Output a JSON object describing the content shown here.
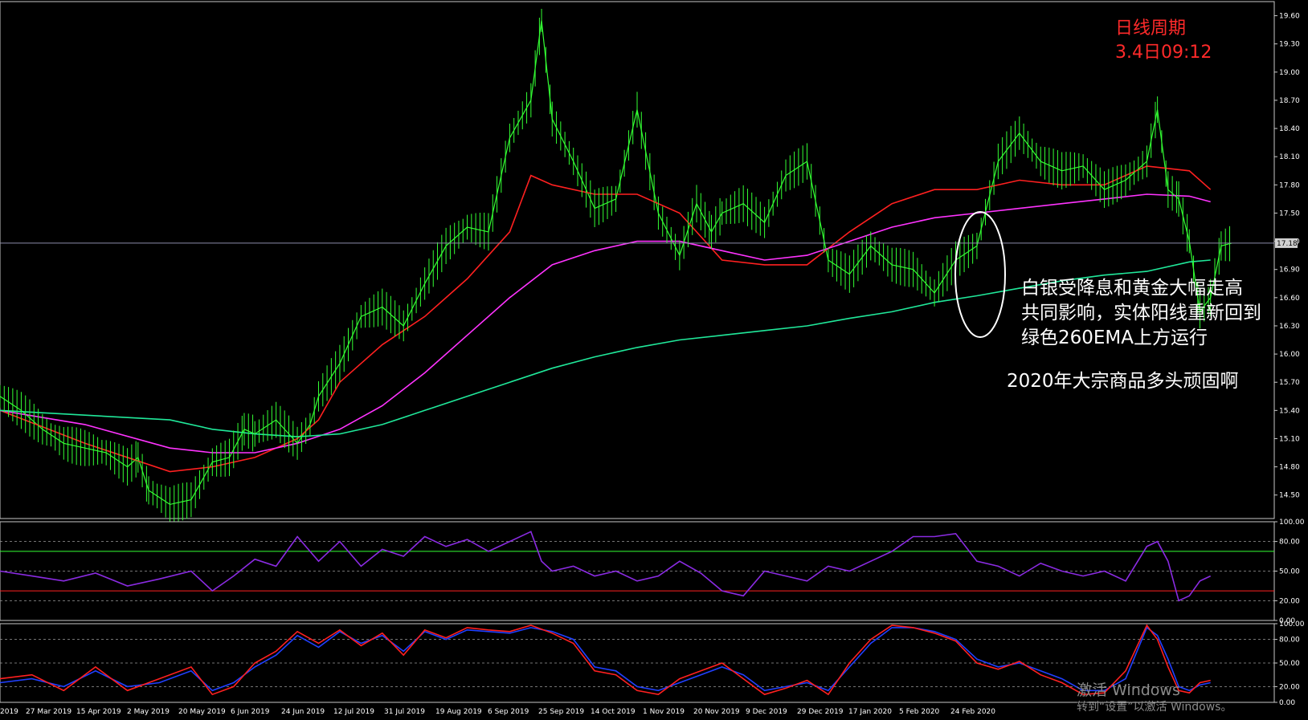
{
  "chart_data": {
    "type": "line",
    "title": "日线周期",
    "timestamp": "3.4日09:12",
    "annotations": [
      "白银受降息和黄金大幅走高",
      "共同影响，实体阳线重新回到",
      "绿色260EMA上方运行",
      "2020年大宗商品多头顽固啊"
    ],
    "current_price_label": "17.18",
    "x_tick_labels": [
      "2019",
      "27 Mar 2019",
      "15 Apr 2019",
      "2 May 2019",
      "20 May 2019",
      "6 Jun 2019",
      "24 Jun 2019",
      "12 Jul 2019",
      "31 Jul 2019",
      "19 Aug 2019",
      "6 Sep 2019",
      "25 Sep 2019",
      "14 Oct 2019",
      "1 Nov 2019",
      "20 Nov 2019",
      "9 Dec 2019",
      "29 Dec 2019",
      "17 Jan 2020",
      "5 Feb 2020",
      "24 Feb 2020"
    ],
    "price_panel": {
      "y_ticks": [
        "19.60",
        "19.30",
        "19.00",
        "18.70",
        "18.40",
        "18.10",
        "17.80",
        "17.50",
        "17.20",
        "16.90",
        "16.60",
        "16.30",
        "16.00",
        "15.70",
        "15.40",
        "15.10",
        "14.80",
        "14.50"
      ],
      "ylim": [
        14.25,
        19.75
      ],
      "series": [
        {
          "color": "#33ff33",
          "x": [
            0,
            10,
            20,
            30,
            40,
            50,
            60,
            65,
            70,
            80,
            90,
            100,
            108,
            115,
            120,
            130,
            140,
            146,
            150,
            160,
            170,
            180,
            190,
            200,
            210,
            220,
            230,
            240,
            250,
            255,
            260,
            270,
            280,
            290,
            300,
            310,
            320,
            328,
            335,
            340,
            350,
            360,
            370,
            380,
            390,
            400,
            410,
            420,
            430,
            440,
            450,
            460,
            470,
            480,
            490,
            500,
            510,
            520
          ],
          "values": [
            15.55,
            15.4,
            15.2,
            15.05,
            15.0,
            14.95,
            14.8,
            14.9,
            14.55,
            14.4,
            14.45,
            14.85,
            14.9,
            15.2,
            15.15,
            15.3,
            15.05,
            15.25,
            15.55,
            15.9,
            16.4,
            16.5,
            16.3,
            16.75,
            17.15,
            17.35,
            17.3,
            18.3,
            18.7,
            19.55,
            18.5,
            18.05,
            17.55,
            17.65,
            18.6,
            17.5,
            17.05,
            17.6,
            17.3,
            17.5,
            17.6,
            17.4,
            17.9,
            18.05,
            17.0,
            16.85,
            17.15,
            16.95,
            16.9,
            16.65,
            17.0,
            17.15,
            18.05,
            18.35,
            18.05,
            17.95,
            18.0,
            17.75
          ]
        },
        {
          "color": "#33ff33",
          "x": [
            520,
            530,
            540,
            545,
            550,
            555,
            560,
            565,
            570,
            575,
            580
          ],
          "values": [
            17.75,
            17.85,
            18.05,
            18.6,
            17.75,
            17.65,
            17.2,
            16.45,
            16.6,
            17.15,
            17.18
          ]
        },
        {
          "color": "#ff2020",
          "x": [
            0,
            40,
            80,
            100,
            120,
            140,
            150,
            160,
            180,
            200,
            220,
            240,
            250,
            260,
            280,
            300,
            320,
            340,
            360,
            380,
            400,
            420,
            440,
            460,
            480,
            500,
            520,
            540,
            560,
            570
          ],
          "values": [
            15.4,
            15.05,
            14.75,
            14.8,
            14.9,
            15.1,
            15.3,
            15.7,
            16.1,
            16.4,
            16.8,
            17.3,
            17.9,
            17.8,
            17.7,
            17.7,
            17.5,
            17.0,
            16.95,
            16.95,
            17.3,
            17.6,
            17.75,
            17.75,
            17.85,
            17.8,
            17.8,
            18.0,
            17.95,
            17.75
          ]
        },
        {
          "color": "#ff33ff",
          "x": [
            0,
            40,
            80,
            100,
            120,
            140,
            160,
            180,
            200,
            220,
            240,
            260,
            280,
            300,
            320,
            340,
            360,
            380,
            400,
            420,
            440,
            460,
            480,
            500,
            520,
            540,
            560,
            570
          ],
          "values": [
            15.4,
            15.25,
            15.0,
            14.95,
            14.95,
            15.05,
            15.2,
            15.45,
            15.8,
            16.2,
            16.6,
            16.95,
            17.1,
            17.2,
            17.2,
            17.1,
            17.0,
            17.05,
            17.2,
            17.35,
            17.45,
            17.5,
            17.55,
            17.6,
            17.65,
            17.7,
            17.68,
            17.62
          ]
        },
        {
          "color": "#20e89a",
          "x": [
            0,
            40,
            80,
            100,
            120,
            140,
            160,
            180,
            200,
            220,
            240,
            260,
            280,
            300,
            320,
            340,
            360,
            380,
            400,
            420,
            440,
            460,
            480,
            500,
            520,
            540,
            560,
            570
          ],
          "values": [
            15.4,
            15.35,
            15.3,
            15.2,
            15.15,
            15.12,
            15.15,
            15.25,
            15.4,
            15.55,
            15.7,
            15.85,
            15.97,
            16.07,
            16.15,
            16.2,
            16.25,
            16.3,
            16.38,
            16.45,
            16.55,
            16.62,
            16.7,
            16.78,
            16.84,
            16.88,
            16.98,
            17.0
          ]
        }
      ]
    },
    "rsi_panel": {
      "y_ticks": [
        "100.00",
        "80.00",
        "50.00",
        "20.00",
        "0.00"
      ],
      "ylim": [
        0,
        100
      ],
      "levels": [
        {
          "value": 70,
          "color": "#33ff33"
        },
        {
          "value": 30,
          "color": "#ff2020"
        }
      ],
      "series": [
        {
          "color": "#8a2be2",
          "x": [
            0,
            15,
            30,
            45,
            60,
            75,
            90,
            100,
            110,
            120,
            130,
            140,
            150,
            160,
            170,
            180,
            190,
            200,
            210,
            220,
            230,
            240,
            250,
            255,
            260,
            270,
            280,
            290,
            300,
            310,
            320,
            330,
            340,
            350,
            360,
            370,
            380,
            390,
            400,
            410,
            420,
            430,
            440,
            450,
            460,
            470,
            480,
            490,
            500,
            510,
            520,
            530,
            540,
            545,
            550,
            555,
            560,
            565,
            570
          ],
          "values": [
            50,
            45,
            40,
            48,
            35,
            42,
            50,
            30,
            45,
            62,
            55,
            85,
            60,
            80,
            55,
            72,
            65,
            85,
            75,
            82,
            70,
            80,
            90,
            60,
            50,
            55,
            45,
            50,
            40,
            45,
            60,
            48,
            30,
            25,
            50,
            45,
            40,
            55,
            50,
            60,
            70,
            85,
            85,
            88,
            60,
            55,
            45,
            58,
            50,
            45,
            50,
            40,
            75,
            80,
            60,
            20,
            25,
            40,
            45
          ]
        }
      ]
    },
    "stoch_panel": {
      "y_ticks": [
        "100.00",
        "80.00",
        "50.00",
        "20.00",
        "0.00"
      ],
      "ylim": [
        0,
        100
      ],
      "series": [
        {
          "color": "#2040ff",
          "x": [
            0,
            15,
            30,
            45,
            60,
            75,
            90,
            100,
            110,
            120,
            130,
            140,
            150,
            160,
            170,
            180,
            190,
            200,
            210,
            220,
            230,
            240,
            250,
            260,
            270,
            280,
            290,
            300,
            310,
            320,
            330,
            340,
            350,
            360,
            370,
            380,
            390,
            400,
            410,
            420,
            430,
            440,
            450,
            460,
            470,
            480,
            490,
            500,
            510,
            520,
            530,
            540,
            545,
            550,
            555,
            560,
            565,
            570
          ],
          "values": [
            25,
            30,
            20,
            40,
            20,
            25,
            40,
            15,
            25,
            45,
            60,
            85,
            70,
            90,
            75,
            85,
            65,
            90,
            80,
            92,
            90,
            88,
            95,
            90,
            80,
            45,
            40,
            20,
            15,
            25,
            35,
            45,
            35,
            15,
            20,
            25,
            15,
            45,
            75,
            95,
            95,
            90,
            80,
            55,
            45,
            50,
            40,
            30,
            15,
            15,
            30,
            95,
            85,
            55,
            20,
            15,
            22,
            25
          ]
        },
        {
          "color": "#ff2020",
          "x": [
            0,
            15,
            30,
            45,
            60,
            75,
            90,
            100,
            110,
            120,
            130,
            140,
            150,
            160,
            170,
            180,
            190,
            200,
            210,
            220,
            230,
            240,
            250,
            260,
            270,
            280,
            290,
            300,
            310,
            320,
            330,
            340,
            350,
            360,
            370,
            380,
            390,
            400,
            410,
            420,
            430,
            440,
            450,
            460,
            470,
            480,
            490,
            500,
            510,
            520,
            530,
            540,
            545,
            550,
            555,
            560,
            565,
            570
          ],
          "values": [
            30,
            35,
            15,
            45,
            15,
            30,
            45,
            10,
            20,
            50,
            65,
            90,
            75,
            92,
            72,
            88,
            60,
            92,
            82,
            95,
            92,
            90,
            98,
            88,
            75,
            40,
            35,
            15,
            10,
            30,
            40,
            50,
            30,
            10,
            18,
            28,
            10,
            50,
            80,
            98,
            95,
            88,
            78,
            50,
            42,
            52,
            35,
            25,
            10,
            12,
            40,
            98,
            80,
            45,
            15,
            12,
            25,
            28
          ]
        }
      ]
    }
  },
  "watermark": {
    "line1": "激活 Windows",
    "line2": "转到“设置”以激活 Windows。"
  },
  "colors": {
    "background": "#000000",
    "candles": "#33ff33",
    "ema_red": "#ff2020",
    "ema_magenta": "#ff33ff",
    "ema_green": "#20e89a",
    "rsi": "#8a2be2",
    "stoch_main": "#2040ff",
    "stoch_signal": "#ff2020",
    "title": "#ff2a2a"
  }
}
